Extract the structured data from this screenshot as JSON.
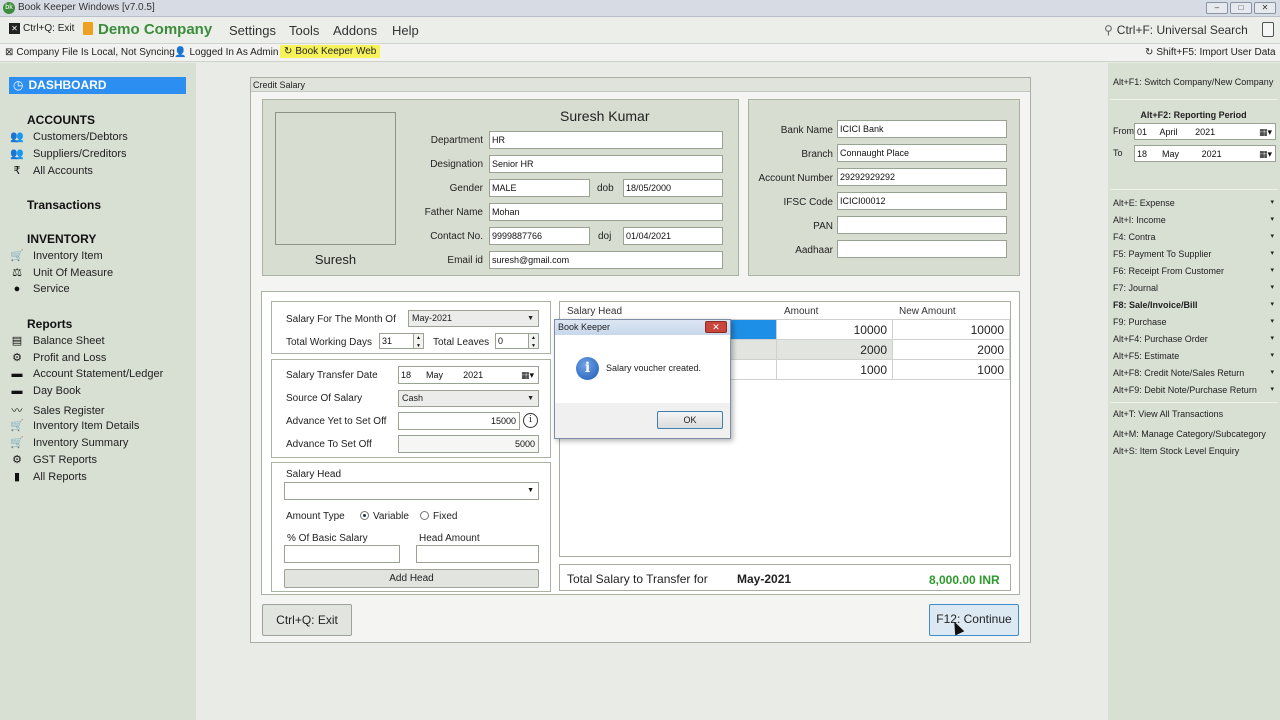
{
  "window": {
    "title": "Book Keeper Windows [v7.0.5]",
    "app_icon": "bk"
  },
  "menubar": {
    "exit": "Ctrl+Q: Exit",
    "company": "Demo Company",
    "items": [
      "Settings",
      "Tools",
      "Addons",
      "Help"
    ],
    "search": "Ctrl+F: Universal Search"
  },
  "statusbar": {
    "sync": "Company File Is Local, Not Syncing",
    "user": "Logged In As Admin",
    "web": "Book Keeper Web",
    "import": "Shift+F5: Import User Data"
  },
  "sidebar": {
    "dashboard": "DASHBOARD",
    "accounts_header": "ACCOUNTS",
    "accounts": [
      "Customers/Debtors",
      "Suppliers/Creditors",
      "All Accounts"
    ],
    "transactions_header": "Transactions",
    "inventory_header": "INVENTORY",
    "inventory": [
      "Inventory Item",
      "Unit Of Measure",
      "Service"
    ],
    "reports_header": "Reports",
    "reports": [
      "Balance Sheet",
      "Profit and Loss",
      "Account Statement/Ledger",
      "Day Book",
      "Sales Register",
      "Inventory Item Details",
      "Inventory Summary",
      "GST Reports",
      "All Reports"
    ]
  },
  "rightpanel": {
    "switch": "Alt+F1: Switch Company/New Company",
    "period_title": "Alt+F2: Reporting Period",
    "from_label": "From",
    "from_day": "01",
    "from_month": "April",
    "from_year": "2021",
    "to_label": "To",
    "to_day": "18",
    "to_month": "May",
    "to_year": "2021",
    "shortcuts": [
      "Alt+E: Expense",
      "Alt+I: Income",
      "F4: Contra",
      "F5: Payment To Supplier",
      "F6: Receipt From Customer",
      "F7: Journal",
      "F8: Sale/Invoice/Bill",
      "F9: Purchase",
      "Alt+F4: Purchase Order",
      "Alt+F5: Estimate",
      "Alt+F8: Credit Note/Sales Return",
      "Alt+F9: Debit Note/Purchase Return"
    ],
    "extras": [
      "Alt+T: View All Transactions",
      "Alt+M: Manage Category/Subcategory",
      "Alt+S: Item Stock Level Enquiry"
    ]
  },
  "dialog": {
    "title": "Credit Salary",
    "employee": {
      "name": "Suresh Kumar",
      "photo_caption": "Suresh",
      "department_label": "Department",
      "department": "HR",
      "designation_label": "Designation",
      "designation": "Senior HR",
      "gender_label": "Gender",
      "gender": "MALE",
      "dob_label": "dob",
      "dob": "18/05/2000",
      "father_label": "Father Name",
      "father": "Mohan",
      "contact_label": "Contact No.",
      "contact": "9999887766",
      "doj_label": "doj",
      "doj": "01/04/2021",
      "email_label": "Email id",
      "email": "suresh@gmail.com"
    },
    "bank": {
      "bank_label": "Bank Name",
      "bank": "ICICI Bank",
      "branch_label": "Branch",
      "branch": "Connaught Place",
      "account_label": "Account Number",
      "account": "29292929292",
      "ifsc_label": "IFSC Code",
      "ifsc": "ICICI00012",
      "pan_label": "PAN",
      "pan": "",
      "aadhaar_label": "Aadhaar",
      "aadhaar": ""
    },
    "salary": {
      "month_label": "Salary For The Month Of",
      "month": "May-2021",
      "working_days_label": "Total Working Days",
      "working_days": "31",
      "leaves_label": "Total Leaves",
      "leaves": "0",
      "transfer_date_label": "Salary Transfer Date",
      "transfer_day": "18",
      "transfer_month": "May",
      "transfer_year": "2021",
      "source_label": "Source Of Salary",
      "source": "Cash",
      "advance_yet_label": "Advance Yet to Set Off",
      "advance_yet": "15000",
      "advance_to_label": "Advance To Set Off",
      "advance_to": "5000",
      "head_label": "Salary Head",
      "head": "",
      "amount_type_label": "Amount Type",
      "variable_label": "Variable",
      "fixed_label": "Fixed",
      "basic_pct_label": "% Of Basic Salary",
      "basic_pct": "",
      "head_amount_label": "Head Amount",
      "head_amount": "",
      "add_head": "Add Head"
    },
    "grid": {
      "headers": [
        "Salary Head",
        "Amount",
        "New Amount"
      ],
      "rows": [
        {
          "head": "",
          "amount": "10000",
          "new_amount": "10000"
        },
        {
          "head": "",
          "amount": "2000",
          "new_amount": "2000"
        },
        {
          "head": "",
          "amount": "1000",
          "new_amount": "1000"
        }
      ]
    },
    "total_label": "Total Salary to Transfer for",
    "total_month": "May-2021",
    "total_amount": "8,000.00 INR",
    "exit_button": "Ctrl+Q: Exit",
    "continue_button": "F12: Continue"
  },
  "messagebox": {
    "title": "Book Keeper",
    "close": "✕",
    "message": "Salary voucher created.",
    "ok": "OK"
  },
  "colors": {
    "accent": "#2c8ef0",
    "brand_green": "#3b8d3b",
    "total_green": "#2e9a2e"
  }
}
